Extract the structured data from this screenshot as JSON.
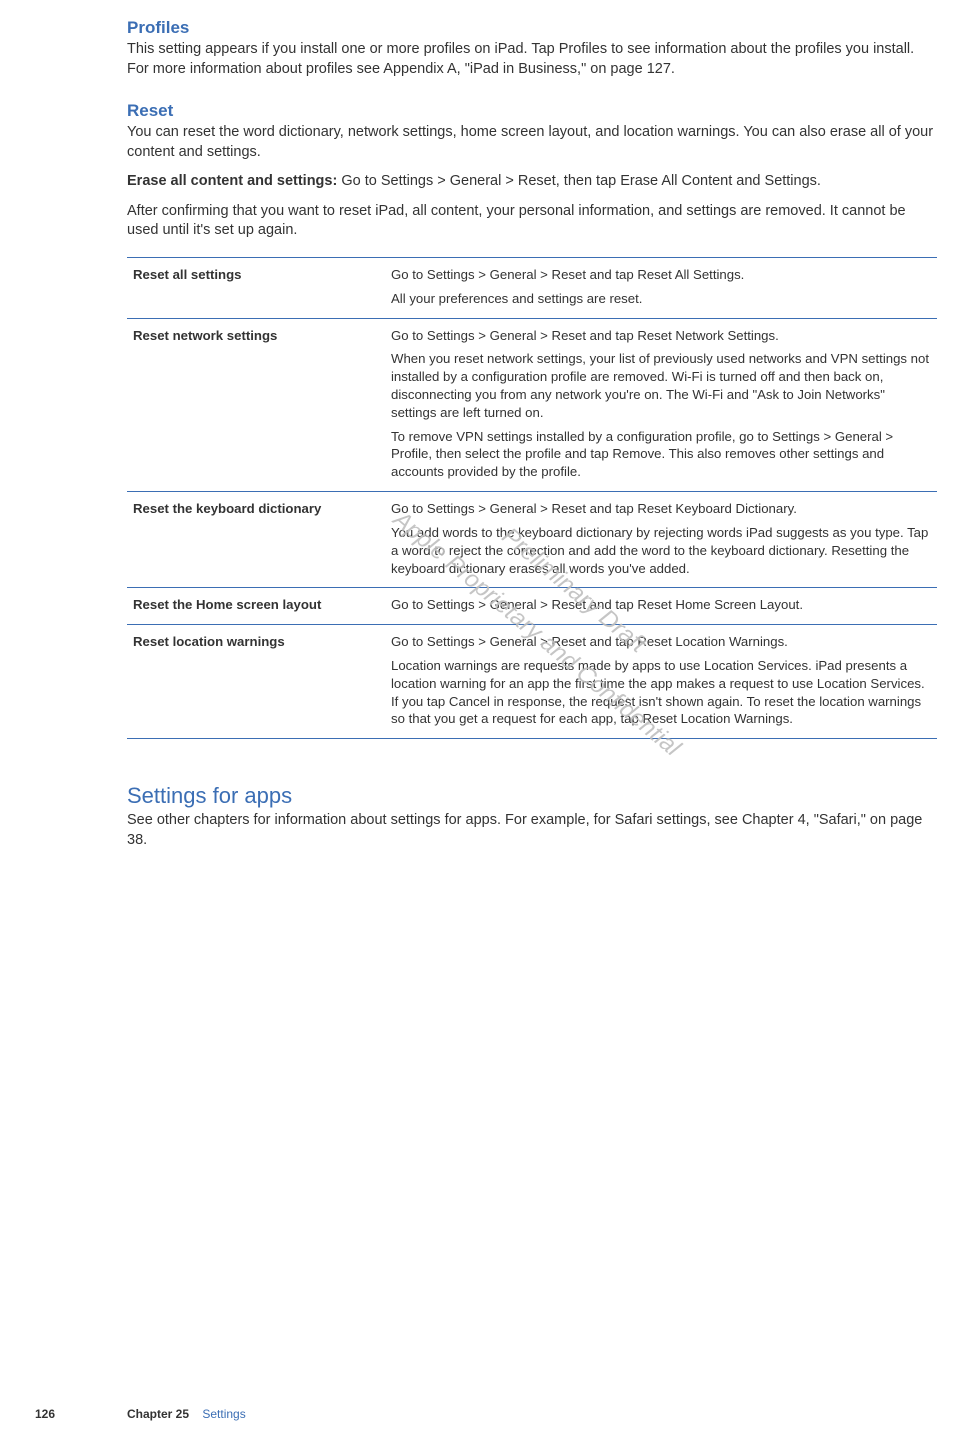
{
  "profiles": {
    "heading": "Profiles",
    "body": "This setting appears if you install one or more profiles on iPad. Tap Profiles to see information about the profiles you install. For more information about profiles see Appendix A, \"iPad in Business,\" on page 127."
  },
  "reset": {
    "heading": "Reset",
    "intro": "You can reset the word dictionary, network settings, home screen layout, and location warnings. You can also erase all of your content and settings.",
    "erase_label": "Erase all content and settings:",
    "erase_body": "  Go to Settings > General > Reset, then tap Erase All Content and Settings.",
    "after": "After confirming that you want to reset iPad, all content, your personal information, and settings are removed. It cannot be used until it's set up again."
  },
  "table": {
    "rows": [
      {
        "label": "Reset all settings",
        "paras": [
          "Go to Settings > General > Reset and tap Reset All Settings.",
          "All your preferences and settings are reset."
        ]
      },
      {
        "label": "Reset network settings",
        "paras": [
          "Go to Settings > General > Reset and tap Reset Network Settings.",
          "When you reset network settings, your list of previously used networks and VPN settings not installed by a configuration profile are removed. Wi-Fi is turned off and then back on, disconnecting you from any network you're on. The Wi-Fi and \"Ask to Join Networks\" settings are left turned on.",
          "To remove VPN settings installed by a configuration profile, go to Settings > General > Profile, then select the profile and tap Remove. This also removes other settings and accounts provided by the profile."
        ]
      },
      {
        "label": "Reset the keyboard dictionary",
        "paras": [
          "Go to Settings > General > Reset and tap Reset Keyboard Dictionary.",
          "You add words to the keyboard dictionary by rejecting words iPad suggests as you type. Tap a word to reject the correction and add the word to the keyboard dictionary. Resetting the keyboard dictionary erases all words you've added."
        ]
      },
      {
        "label": "Reset the Home screen layout",
        "paras": [
          "Go to Settings > General > Reset and tap Reset Home Screen Layout."
        ]
      },
      {
        "label": "Reset location warnings",
        "paras": [
          "Go to Settings > General > Reset and tap Reset Location Warnings.",
          "Location warnings are requests made by apps to use Location Services. iPad presents a location warning for an app the first time the app makes a request to use Location Services. If you tap Cancel in response, the request isn't shown again. To reset the location warnings so that you get a request for each app, tap Reset Location Warnings."
        ]
      }
    ]
  },
  "settings_for_apps": {
    "heading": "Settings for apps",
    "body": "See other chapters for information about settings for apps. For example, for Safari settings, see Chapter 4, \"Safari,\" on page 38."
  },
  "watermark": {
    "line1": "Preliminary Draft",
    "line2": "Apple Proprietary and Confidential"
  },
  "footer": {
    "page": "126",
    "chapter": "Chapter 25",
    "title": "Settings"
  }
}
